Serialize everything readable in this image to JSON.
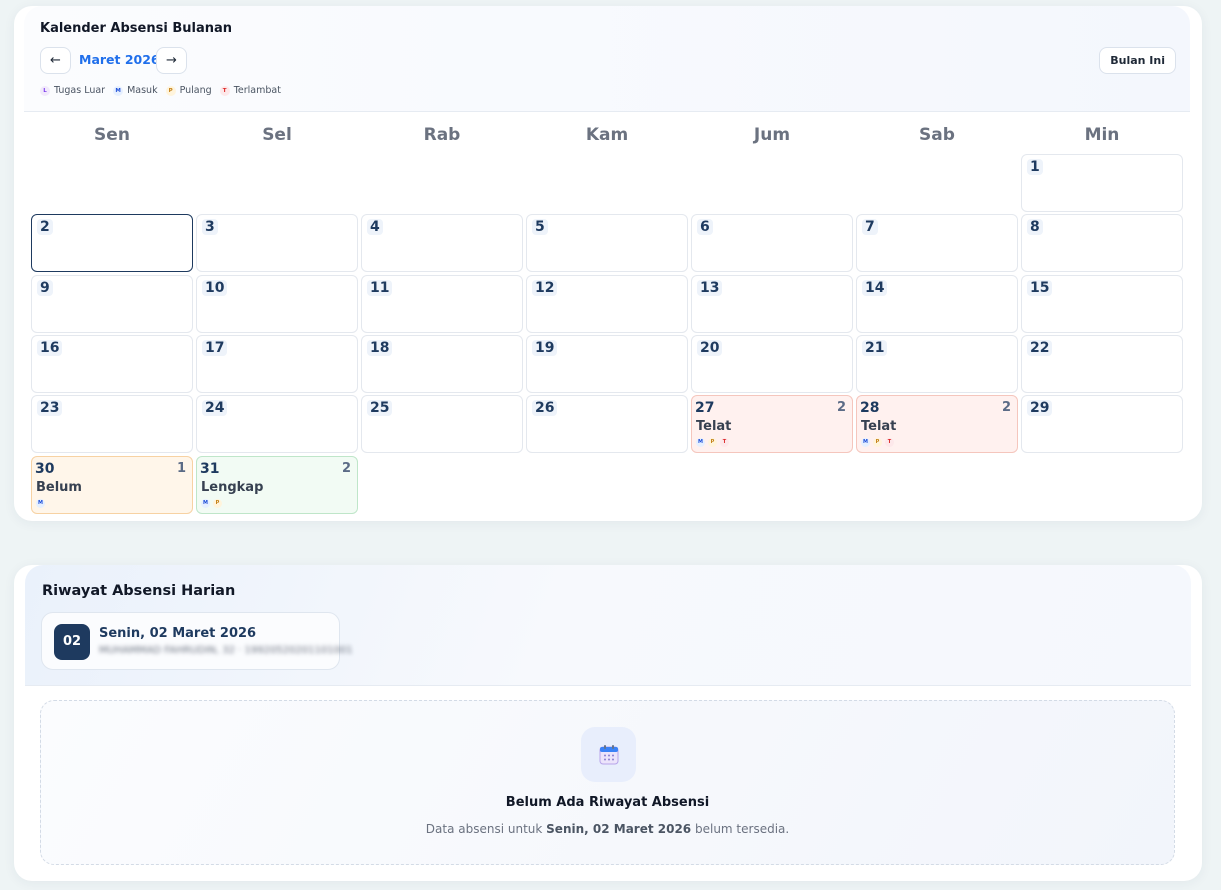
{
  "calendar": {
    "title": "Kalender Absensi Bulanan",
    "month_label": "Maret 2026",
    "prev_icon": "←",
    "next_icon": "→",
    "today_label": "Bulan Ini",
    "legend": [
      {
        "code": "L",
        "label": "Tugas Luar"
      },
      {
        "code": "M",
        "label": "Masuk"
      },
      {
        "code": "P",
        "label": "Pulang"
      },
      {
        "code": "T",
        "label": "Terlambat"
      }
    ],
    "weekdays": [
      "Sen",
      "Sel",
      "Rab",
      "Kam",
      "Jum",
      "Sab",
      "Min"
    ],
    "days": [
      {
        "day": "1"
      },
      {
        "day": "2",
        "selected": true
      },
      {
        "day": "3"
      },
      {
        "day": "4"
      },
      {
        "day": "5"
      },
      {
        "day": "6"
      },
      {
        "day": "7"
      },
      {
        "day": "8"
      },
      {
        "day": "9"
      },
      {
        "day": "10"
      },
      {
        "day": "11"
      },
      {
        "day": "12"
      },
      {
        "day": "13"
      },
      {
        "day": "14"
      },
      {
        "day": "15"
      },
      {
        "day": "16"
      },
      {
        "day": "17"
      },
      {
        "day": "18"
      },
      {
        "day": "19"
      },
      {
        "day": "20"
      },
      {
        "day": "21"
      },
      {
        "day": "22"
      },
      {
        "day": "23"
      },
      {
        "day": "24"
      },
      {
        "day": "25"
      },
      {
        "day": "26"
      },
      {
        "day": "27",
        "count": "2",
        "status": "Telat",
        "markers": [
          "M",
          "P",
          "T"
        ],
        "state": "late"
      },
      {
        "day": "28",
        "count": "2",
        "status": "Telat",
        "markers": [
          "M",
          "P",
          "T"
        ],
        "state": "late"
      },
      {
        "day": "29"
      },
      {
        "day": "30",
        "count": "1",
        "status": "Belum",
        "markers": [
          "M"
        ],
        "state": "pending"
      },
      {
        "day": "31",
        "count": "2",
        "status": "Lengkap",
        "markers": [
          "M",
          "P"
        ],
        "state": "complete"
      }
    ]
  },
  "history": {
    "title": "Riwayat Absensi Harian",
    "date_badge": "02",
    "date_full": "Senin, 02 Maret 2026",
    "date_sub": "MUHAMMAD FAHRUDIN, 32 · 19920520201101001",
    "empty_icon": "calendar-icon",
    "empty_title": "Belum Ada Riwayat Absensi",
    "empty_desc_before": "Data absensi untuk ",
    "empty_desc_date": "Senin, 02 Maret 2026",
    "empty_desc_after": " belum tersedia."
  },
  "colors": {
    "primary": "#1e3a5f",
    "accent": "#1f6feb",
    "late_bg": "#fff1ef",
    "pending_bg": "#fff6ea",
    "complete_bg": "#f2fbf4"
  }
}
